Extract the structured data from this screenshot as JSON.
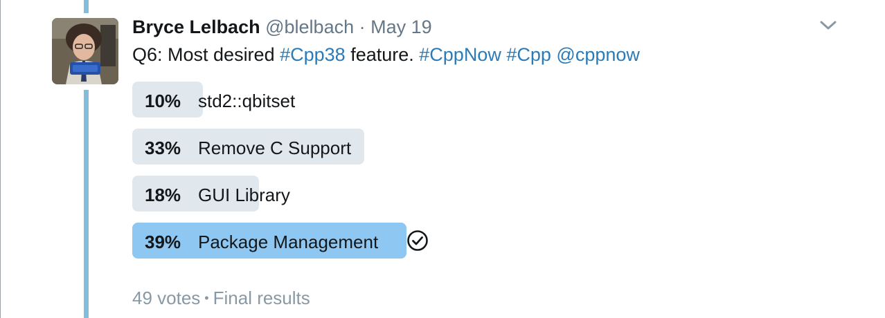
{
  "tweet": {
    "author_name": "Bryce Lelbach",
    "handle": "@blelbach",
    "separator": "·",
    "date": "May 19",
    "text_parts": [
      {
        "text": "Q6: Most desired ",
        "type": "plain"
      },
      {
        "text": "#Cpp38",
        "type": "hashtag"
      },
      {
        "text": " feature. ",
        "type": "plain"
      },
      {
        "text": "#CppNow",
        "type": "hashtag"
      },
      {
        "text": " ",
        "type": "plain"
      },
      {
        "text": "#Cpp",
        "type": "hashtag"
      },
      {
        "text": " ",
        "type": "plain"
      },
      {
        "text": "@cppnow",
        "type": "mention"
      }
    ]
  },
  "poll": {
    "options": [
      {
        "percent": "10%",
        "label": "std2::qbitset",
        "winner": false
      },
      {
        "percent": "33%",
        "label": "Remove C Support",
        "winner": false
      },
      {
        "percent": "18%",
        "label": "GUI Library",
        "winner": false
      },
      {
        "percent": "39%",
        "label": "Package Management",
        "winner": true
      }
    ],
    "votes": "49 votes",
    "bullet": "•",
    "status": "Final results"
  },
  "icons": {
    "more": "chevron-down-icon",
    "winner": "check-circle-icon"
  },
  "colors": {
    "link": "#2b7bb9",
    "thread_line": "#84bcd9",
    "bar": "#e1e8ed",
    "winner_bar": "#8ec8f2",
    "muted": "#657786"
  }
}
